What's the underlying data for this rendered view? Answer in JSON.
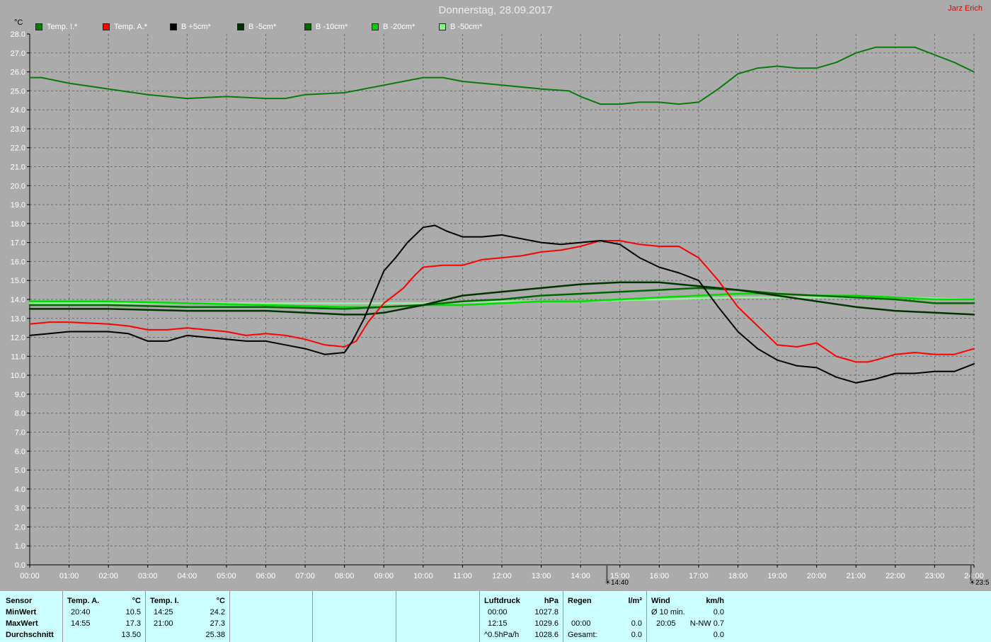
{
  "header": {
    "title": "Donnerstag, 28.09.2017",
    "author": "Jarz Erich",
    "unit": "°C"
  },
  "legend": [
    {
      "label": "Temp. I.*",
      "color": "#008000"
    },
    {
      "label": "Temp. A.*",
      "color": "#ff0000"
    },
    {
      "label": "B +5cm*",
      "color": "#000000"
    },
    {
      "label": "B -5cm*",
      "color": "#003300"
    },
    {
      "label": "B -10cm*",
      "color": "#006600"
    },
    {
      "label": "B -20cm*",
      "color": "#00cc00"
    },
    {
      "label": "B -50cm*",
      "color": "#88ee88"
    }
  ],
  "markers": {
    "sunrise": "14:40",
    "sunset": "23:5"
  },
  "chart_data": {
    "type": "line",
    "title": "Donnerstag, 28.09.2017",
    "ylabel": "°C",
    "ylim": [
      0,
      28
    ],
    "xlim": [
      0,
      24
    ],
    "grid": true,
    "legend_position": "top",
    "x_ticks": [
      "00:00",
      "01:00",
      "02:00",
      "03:00",
      "04:00",
      "05:00",
      "06:00",
      "07:00",
      "08:00",
      "09:00",
      "10:00",
      "11:00",
      "12:00",
      "13:00",
      "14:00",
      "15:00",
      "16:00",
      "17:00",
      "18:00",
      "19:00",
      "20:00",
      "21:00",
      "22:00",
      "23:00",
      "24:00"
    ],
    "y_ticks": [
      "0.0",
      "1.0",
      "2.0",
      "3.0",
      "4.0",
      "5.0",
      "6.0",
      "7.0",
      "8.0",
      "9.0",
      "10.0",
      "11.0",
      "12.0",
      "13.0",
      "14.0",
      "15.0",
      "16.0",
      "17.0",
      "18.0",
      "19.0",
      "20.0",
      "21.0",
      "22.0",
      "23.0",
      "24.0",
      "25.0",
      "26.0",
      "27.0",
      "28.0"
    ],
    "series": [
      {
        "name": "Temp. I.*",
        "color": "#0a7a0a",
        "width": 2,
        "x": [
          0,
          0.3,
          1,
          2,
          3,
          4,
          5,
          6,
          6.5,
          7,
          8,
          9,
          10,
          10.5,
          11,
          12,
          13,
          13.7,
          14,
          14.5,
          15,
          15.5,
          16,
          16.5,
          17,
          17.5,
          18,
          18.5,
          19,
          19.5,
          20,
          20.5,
          21,
          21.5,
          22,
          22.5,
          23,
          23.5,
          24
        ],
        "y": [
          25.7,
          25.7,
          25.4,
          25.1,
          24.8,
          24.6,
          24.7,
          24.6,
          24.6,
          24.8,
          24.9,
          25.3,
          25.7,
          25.7,
          25.5,
          25.3,
          25.1,
          25.0,
          24.7,
          24.3,
          24.3,
          24.4,
          24.4,
          24.3,
          24.4,
          25.1,
          25.9,
          26.2,
          26.3,
          26.2,
          26.2,
          26.5,
          27.0,
          27.3,
          27.3,
          27.3,
          26.9,
          26.5,
          26.0
        ]
      },
      {
        "name": "Temp. A.*",
        "color": "#ff0000",
        "width": 2,
        "x": [
          0,
          0.5,
          1,
          2,
          2.5,
          3,
          3.5,
          4,
          4.5,
          5,
          5.5,
          6,
          6.5,
          7,
          7.5,
          8,
          8.3,
          8.6,
          9,
          9.5,
          9.8,
          10,
          10.5,
          11,
          11.5,
          12,
          12.5,
          13,
          13.5,
          14,
          14.5,
          15,
          15.5,
          16,
          16.5,
          17,
          17.5,
          18,
          18.5,
          19,
          19.5,
          20,
          20.5,
          21,
          21.3,
          21.5,
          22,
          22.5,
          23,
          23.5,
          24
        ],
        "y": [
          12.7,
          12.8,
          12.8,
          12.7,
          12.6,
          12.4,
          12.4,
          12.5,
          12.4,
          12.3,
          12.1,
          12.2,
          12.1,
          11.9,
          11.6,
          11.5,
          11.8,
          12.8,
          13.8,
          14.6,
          15.3,
          15.7,
          15.8,
          15.8,
          16.1,
          16.2,
          16.3,
          16.5,
          16.6,
          16.8,
          17.1,
          17.1,
          16.9,
          16.8,
          16.8,
          16.2,
          15.0,
          13.6,
          12.6,
          11.6,
          11.5,
          11.7,
          11.0,
          10.7,
          10.7,
          10.8,
          11.1,
          11.2,
          11.1,
          11.1,
          11.4
        ]
      },
      {
        "name": "B +5cm*",
        "color": "#000000",
        "width": 2,
        "x": [
          0,
          0.5,
          1,
          2,
          2.5,
          3,
          3.5,
          4,
          4.5,
          5,
          5.5,
          6,
          6.5,
          7,
          7.5,
          8,
          8.2,
          8.5,
          8.8,
          9,
          9.3,
          9.6,
          10,
          10.3,
          10.6,
          11,
          11.5,
          12,
          12.5,
          13,
          13.5,
          14,
          14.5,
          15,
          15.5,
          16,
          16.5,
          17,
          17.5,
          18,
          18.5,
          19,
          19.5,
          20,
          20.5,
          21,
          21.5,
          22,
          22.5,
          23,
          23.5,
          24
        ],
        "y": [
          12.1,
          12.2,
          12.3,
          12.3,
          12.2,
          11.8,
          11.8,
          12.1,
          12.0,
          11.9,
          11.8,
          11.8,
          11.6,
          11.4,
          11.1,
          11.2,
          11.8,
          13.0,
          14.5,
          15.5,
          16.2,
          17.0,
          17.8,
          17.9,
          17.6,
          17.3,
          17.3,
          17.4,
          17.2,
          17.0,
          16.9,
          17.0,
          17.1,
          16.9,
          16.2,
          15.7,
          15.4,
          15.0,
          13.6,
          12.3,
          11.4,
          10.8,
          10.5,
          10.4,
          9.9,
          9.6,
          9.8,
          10.1,
          10.1,
          10.2,
          10.2,
          10.6
        ]
      },
      {
        "name": "B -5cm*",
        "color": "#003300",
        "width": 2.5,
        "x": [
          0,
          2,
          4,
          6,
          7,
          8,
          8.5,
          9,
          10,
          11,
          12,
          13,
          14,
          15,
          16,
          16.5,
          17,
          17.5,
          18,
          19,
          20,
          21,
          22,
          23,
          24
        ],
        "y": [
          13.5,
          13.5,
          13.4,
          13.4,
          13.3,
          13.2,
          13.2,
          13.3,
          13.7,
          14.2,
          14.4,
          14.6,
          14.8,
          14.9,
          14.9,
          14.8,
          14.7,
          14.6,
          14.5,
          14.2,
          13.9,
          13.6,
          13.4,
          13.3,
          13.2
        ]
      },
      {
        "name": "B -10cm*",
        "color": "#006600",
        "width": 2.5,
        "x": [
          0,
          2,
          4,
          6,
          8,
          9,
          10,
          11,
          12,
          13,
          14,
          15,
          16,
          17,
          18,
          19,
          20,
          21,
          22,
          23,
          24
        ],
        "y": [
          13.7,
          13.7,
          13.6,
          13.6,
          13.5,
          13.6,
          13.7,
          13.9,
          14.0,
          14.2,
          14.3,
          14.4,
          14.5,
          14.6,
          14.5,
          14.3,
          14.2,
          14.1,
          14.0,
          13.8,
          13.8
        ]
      },
      {
        "name": "B -20cm*",
        "color": "#00dd00",
        "width": 2.5,
        "x": [
          0,
          2,
          4,
          6,
          8,
          9,
          10,
          11,
          12,
          13,
          14,
          15,
          16,
          17,
          18,
          19,
          20,
          21,
          22,
          23,
          24
        ],
        "y": [
          13.9,
          13.9,
          13.8,
          13.7,
          13.6,
          13.6,
          13.7,
          13.7,
          13.8,
          13.9,
          13.9,
          14.0,
          14.1,
          14.2,
          14.3,
          14.3,
          14.2,
          14.2,
          14.1,
          14.0,
          14.0
        ]
      },
      {
        "name": "B -50cm*",
        "color": "#99ee99",
        "width": 2.5,
        "x": [
          0,
          2,
          4,
          6,
          8,
          10,
          12,
          14,
          16,
          18,
          20,
          22,
          24
        ],
        "y": [
          13.8,
          13.8,
          13.8,
          13.8,
          13.8,
          13.8,
          13.9,
          13.9,
          14.0,
          14.1,
          14.1,
          14.1,
          14.0
        ]
      }
    ]
  },
  "stats": {
    "sensor": {
      "title": "Sensor",
      "min": "MinWert",
      "max": "MaxWert",
      "avg": "Durchschnitt"
    },
    "temp_a": {
      "title": "Temp. A.",
      "unit": "°C",
      "min_time": "20:40",
      "min_val": "10.5",
      "max_time": "14:55",
      "max_val": "17.3",
      "avg": "13.50"
    },
    "temp_i": {
      "title": "Temp. I.",
      "unit": "°C",
      "min_time": "14:25",
      "min_val": "24.2",
      "max_time": "21:00",
      "max_val": "27.3",
      "avg": "25.38"
    },
    "pressure": {
      "title": "Luftdruck",
      "unit": "hPa",
      "r1_label": "00:00",
      "r1_val": "1027.8",
      "r2_label": "12:15",
      "r2_val": "1029.6",
      "r3_label": "^0.5hPa/h",
      "r3_val": "1028.6"
    },
    "rain": {
      "title": "Regen",
      "unit": "l/m²",
      "r2_label": "00:00",
      "r2_val": "0.0",
      "r3_label": "Gesamt:",
      "r3_val": "0.0"
    },
    "wind": {
      "title": "Wind",
      "unit": "km/h",
      "r1_label": "Ø 10 min.",
      "r1_val": "0.0",
      "r2_label": "20:05",
      "r2_val": "N-NW 0.7",
      "r3_val": "0.0"
    }
  }
}
